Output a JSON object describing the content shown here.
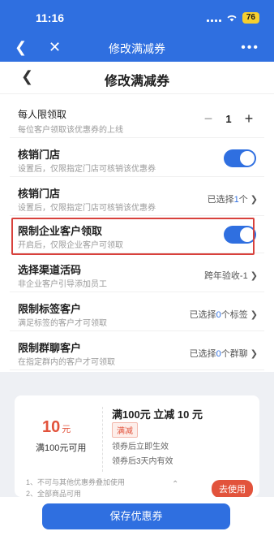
{
  "status_bar": {
    "time": "11:16",
    "battery": "76"
  },
  "nav": {
    "title": "修改满减券"
  },
  "page": {
    "title": "修改满减券"
  },
  "limit_per_person": {
    "label": "每人限领取",
    "desc": "每位客户领取该优惠券的上线",
    "value": "1"
  },
  "store_verify_toggle": {
    "label": "核销门店",
    "desc": "设置后，仅限指定门店可核销该优惠券"
  },
  "store_verify_select": {
    "label": "核销门店",
    "desc": "设置后，仅限指定门店可核销该优惠券",
    "value_prefix": "已选择",
    "value_count": "1",
    "value_suffix": "个"
  },
  "enterprise_limit": {
    "label": "限制企业客户领取",
    "desc": "开启后，仅限企业客户可领取"
  },
  "channel_code": {
    "label": "选择渠道活码",
    "desc": "非企业客户引导添加员工",
    "value": "跨年验收-1"
  },
  "tag_limit": {
    "label": "限制标签客户",
    "desc": "满足标签的客户才可领取",
    "value_prefix": "已选择",
    "value_count": "0",
    "value_suffix": "个标签"
  },
  "group_limit": {
    "label": "限制群聊客户",
    "desc": "在指定群内的客户才可领取",
    "value_prefix": "已选择",
    "value_count": "0",
    "value_suffix": "个群聊"
  },
  "coupon_preview": {
    "amount": "10",
    "unit": "元",
    "condition": "满100元可用",
    "name": "满100元 立减 10 元",
    "tag": "满减",
    "effective": "领券后立即生效",
    "validity": "领券后3天内有效",
    "rule1": "1、不可与其他优惠券叠加使用",
    "rule2": "2、全部商品可用",
    "use_label": "去使用"
  },
  "save_label": "保存优惠券",
  "colors": {
    "primary": "#2f6fe0",
    "accent": "#e2533c",
    "highlight": "#d8413c"
  }
}
